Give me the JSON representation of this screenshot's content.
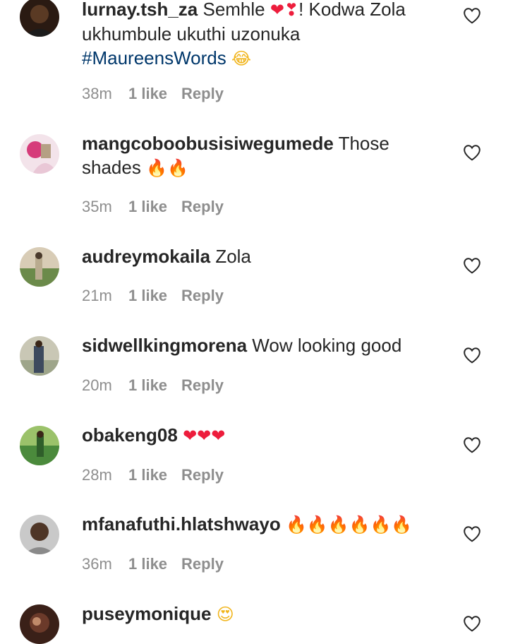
{
  "comments": [
    {
      "username": "lurnay.tsh_za",
      "segments": [
        {
          "type": "text",
          "value": " Semhle "
        },
        {
          "type": "emoji",
          "kind": "heart",
          "value": "❤"
        },
        {
          "type": "emoji",
          "kind": "heart",
          "value": "❣"
        },
        {
          "type": "text",
          "value": "! Kodwa Zola ukhumbule ukuthi uzonuka "
        },
        {
          "type": "hashtag",
          "value": "#MaureensWords"
        },
        {
          "type": "text",
          "value": " "
        },
        {
          "type": "emoji",
          "kind": "face",
          "value": "😂"
        }
      ],
      "time": "38m",
      "likes": "1 like",
      "reply": "Reply",
      "avatar_colors": [
        "#2a1a12",
        "#5a3a24",
        "#1c1c1c"
      ]
    },
    {
      "username": "mangcoboobusisiwegumede",
      "segments": [
        {
          "type": "text",
          "value": " Those shades "
        },
        {
          "type": "emoji",
          "kind": "fire",
          "value": "🔥🔥"
        }
      ],
      "time": "35m",
      "likes": "1 like",
      "reply": "Reply",
      "avatar_colors": [
        "#e9c7d6",
        "#d63b7a",
        "#f3e3ea"
      ]
    },
    {
      "username": "audreymokaila",
      "segments": [
        {
          "type": "text",
          "value": " Zola"
        }
      ],
      "time": "21m",
      "likes": "1 like",
      "reply": "Reply",
      "avatar_colors": [
        "#b9ab8f",
        "#6b8a4a",
        "#d8ccb6"
      ]
    },
    {
      "username": "sidwellkingmorena",
      "segments": [
        {
          "type": "text",
          "value": " Wow looking good"
        }
      ],
      "time": "20m",
      "likes": "1 like",
      "reply": "Reply",
      "avatar_colors": [
        "#9ea58a",
        "#3d4a5e",
        "#c9c7b5"
      ]
    },
    {
      "username": "obakeng08",
      "segments": [
        {
          "type": "text",
          "value": " "
        },
        {
          "type": "emoji",
          "kind": "heart",
          "value": "❤❤❤"
        }
      ],
      "time": "28m",
      "likes": "1 like",
      "reply": "Reply",
      "avatar_colors": [
        "#4b8a3c",
        "#2f5e2a",
        "#9bc26a"
      ]
    },
    {
      "username": "mfanafuthi.hlatshwayo",
      "segments": [
        {
          "type": "text",
          "value": " "
        },
        {
          "type": "emoji",
          "kind": "fire",
          "value": "🔥🔥🔥🔥🔥🔥"
        }
      ],
      "time": "36m",
      "likes": "1 like",
      "reply": "Reply",
      "avatar_colors": [
        "#c9c9c9",
        "#4e3526",
        "#8a8a8a"
      ]
    },
    {
      "username": "puseymonique",
      "segments": [
        {
          "type": "text",
          "value": " "
        },
        {
          "type": "emoji",
          "kind": "face",
          "value": "😍"
        }
      ],
      "time": "",
      "likes": "",
      "reply": "",
      "avatar_colors": [
        "#6b3a2a",
        "#c08a6a",
        "#3a2018"
      ]
    }
  ]
}
